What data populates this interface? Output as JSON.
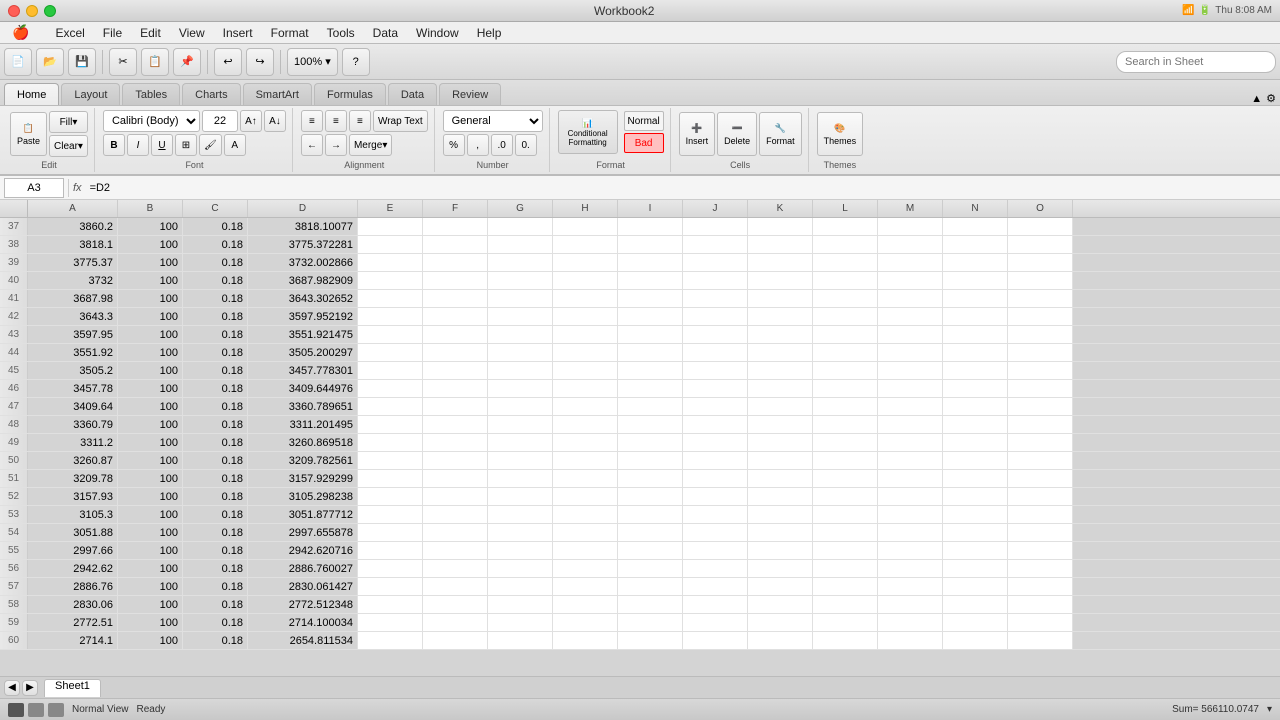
{
  "titlebar": {
    "title": "Workbook2",
    "app": "Excel"
  },
  "menubar": {
    "apple": "🍎",
    "items": [
      "Excel",
      "File",
      "Edit",
      "View",
      "Insert",
      "Format",
      "Tools",
      "Data",
      "Window",
      "Help"
    ]
  },
  "ribbon_tabs": {
    "tabs": [
      "Home",
      "Layout",
      "Tables",
      "Charts",
      "SmartArt",
      "Formulas",
      "Data",
      "Review"
    ],
    "active": "Home"
  },
  "ribbon": {
    "groups": {
      "edit": "Edit",
      "font": "Font",
      "alignment": "Alignment",
      "number": "Number",
      "format": "Format",
      "cells": "Cells",
      "themes": "Themes"
    },
    "font_name": "Calibri (Body)",
    "font_size": "22",
    "number_format": "General",
    "style_normal": "Normal",
    "style_bad": "Bad",
    "fill_label": "Fill",
    "clear_label": "Clear",
    "paste_label": "Paste",
    "insert_label": "Insert",
    "delete_label": "Delete",
    "format_label": "Format",
    "wrap_text": "Wrap Text",
    "merge_label": "Merge",
    "conditional_label": "Conditional\nFormatting"
  },
  "formula_bar": {
    "cell_ref": "A3",
    "formula": "=D2"
  },
  "columns": {
    "headers": [
      "A",
      "B",
      "C",
      "D",
      "E",
      "F",
      "G",
      "H",
      "I",
      "J",
      "K",
      "L",
      "M",
      "N",
      "O"
    ],
    "widths": [
      90,
      65,
      65,
      110,
      65,
      65,
      65,
      65,
      65,
      65,
      65,
      65,
      65,
      65,
      65
    ]
  },
  "rows": [
    {
      "num": 37,
      "a": "3860.2",
      "b": "100",
      "c": "0.18",
      "d": "3818.10077"
    },
    {
      "num": 38,
      "a": "3818.1",
      "b": "100",
      "c": "0.18",
      "d": "3775.372281"
    },
    {
      "num": 39,
      "a": "3775.37",
      "b": "100",
      "c": "0.18",
      "d": "3732.002866"
    },
    {
      "num": 40,
      "a": "3732",
      "b": "100",
      "c": "0.18",
      "d": "3687.982909"
    },
    {
      "num": 41,
      "a": "3687.98",
      "b": "100",
      "c": "0.18",
      "d": "3643.302652"
    },
    {
      "num": 42,
      "a": "3643.3",
      "b": "100",
      "c": "0.18",
      "d": "3597.952192"
    },
    {
      "num": 43,
      "a": "3597.95",
      "b": "100",
      "c": "0.18",
      "d": "3551.921475"
    },
    {
      "num": 44,
      "a": "3551.92",
      "b": "100",
      "c": "0.18",
      "d": "3505.200297"
    },
    {
      "num": 45,
      "a": "3505.2",
      "b": "100",
      "c": "0.18",
      "d": "3457.778301"
    },
    {
      "num": 46,
      "a": "3457.78",
      "b": "100",
      "c": "0.18",
      "d": "3409.644976"
    },
    {
      "num": 47,
      "a": "3409.64",
      "b": "100",
      "c": "0.18",
      "d": "3360.789651"
    },
    {
      "num": 48,
      "a": "3360.79",
      "b": "100",
      "c": "0.18",
      "d": "3311.201495"
    },
    {
      "num": 49,
      "a": "3311.2",
      "b": "100",
      "c": "0.18",
      "d": "3260.869518"
    },
    {
      "num": 50,
      "a": "3260.87",
      "b": "100",
      "c": "0.18",
      "d": "3209.782561"
    },
    {
      "num": 51,
      "a": "3209.78",
      "b": "100",
      "c": "0.18",
      "d": "3157.929299"
    },
    {
      "num": 52,
      "a": "3157.93",
      "b": "100",
      "c": "0.18",
      "d": "3105.298238"
    },
    {
      "num": 53,
      "a": "3105.3",
      "b": "100",
      "c": "0.18",
      "d": "3051.877712"
    },
    {
      "num": 54,
      "a": "3051.88",
      "b": "100",
      "c": "0.18",
      "d": "2997.655878"
    },
    {
      "num": 55,
      "a": "2997.66",
      "b": "100",
      "c": "0.18",
      "d": "2942.620716"
    },
    {
      "num": 56,
      "a": "2942.62",
      "b": "100",
      "c": "0.18",
      "d": "2886.760027"
    },
    {
      "num": 57,
      "a": "2886.76",
      "b": "100",
      "c": "0.18",
      "d": "2830.061427"
    },
    {
      "num": 58,
      "a": "2830.06",
      "b": "100",
      "c": "0.18",
      "d": "2772.512348"
    },
    {
      "num": 59,
      "a": "2772.51",
      "b": "100",
      "c": "0.18",
      "d": "2714.100034"
    },
    {
      "num": 60,
      "a": "2714.1",
      "b": "100",
      "c": "0.18",
      "d": "2654.811534"
    }
  ],
  "sheet_tabs": [
    "Sheet1"
  ],
  "status_bar": {
    "mode": "Normal View",
    "state": "Ready",
    "sum": "Sum= 566110.0747"
  }
}
